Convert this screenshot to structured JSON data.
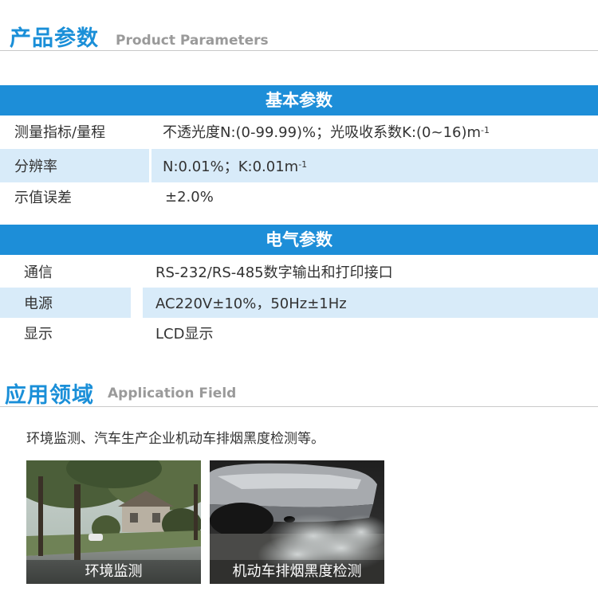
{
  "params_header": {
    "title": "产品参数",
    "subtitle": "Product Parameters"
  },
  "basic": {
    "band_title": "基本参数",
    "rows": [
      {
        "label": "测量指标/量程",
        "value": "不透光度N:(0-99.99)%；光吸收系数K:(0~16)m",
        "sup": "-1"
      },
      {
        "label": "分辨率",
        "value": "N:0.01%；K:0.01m",
        "sup": "-1"
      },
      {
        "label": "示值误差",
        "value": "±2.0%"
      }
    ]
  },
  "electrical": {
    "band_title": "电气参数",
    "rows": [
      {
        "label": "通信",
        "value": "RS-232/RS-485数字输出和打印接口"
      },
      {
        "label": "电源",
        "value": "AC220V±10%，50Hz±1Hz"
      },
      {
        "label": "显示",
        "value": "LCD显示"
      }
    ]
  },
  "application_header": {
    "title": "应用领域",
    "subtitle": "Application Field"
  },
  "application": {
    "description": "环境监测、汽车生产企业机动车排烟黑度检测等。",
    "images": [
      {
        "caption": "环境监测"
      },
      {
        "caption": "机动车排烟黑度检测"
      }
    ]
  }
}
